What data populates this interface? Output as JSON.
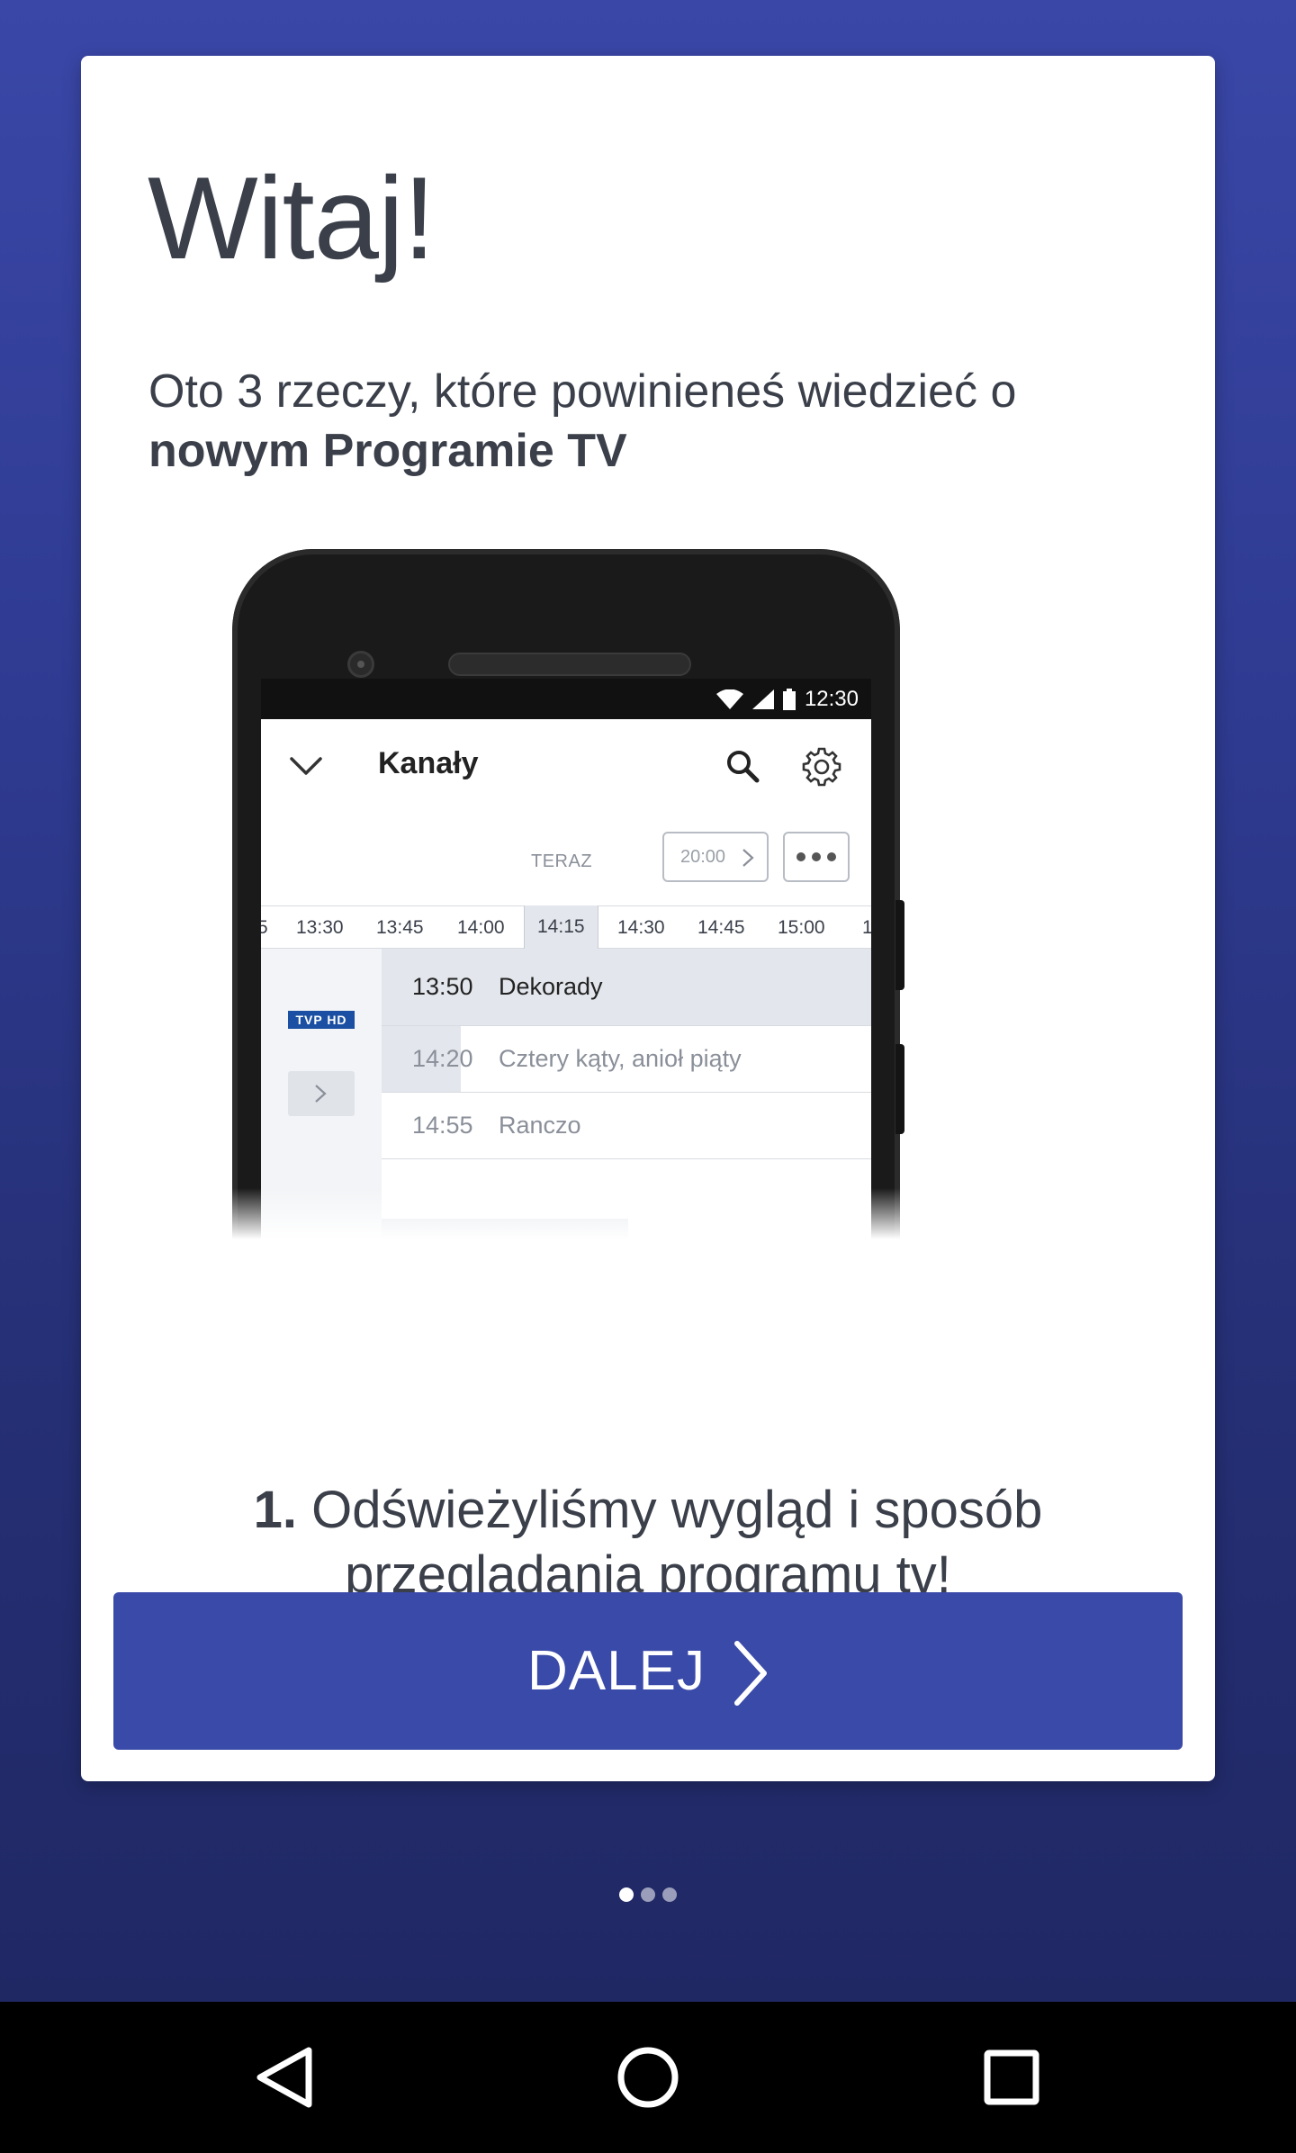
{
  "card": {
    "title": "Witaj!",
    "subtitle_intro": "Oto 3 rzeczy, które powinieneś wiedzieć o",
    "subtitle_bold": "nowym Programie TV"
  },
  "phone_screen": {
    "status_time": "12:30",
    "appbar_title": "Kanały",
    "teraz_label": "TERAZ",
    "time_button": "20:00",
    "timeline_ticks": [
      "5",
      "13:30",
      "13:45",
      "14:00",
      "14:15",
      "14:30",
      "14:45",
      "15:00",
      "1"
    ],
    "timeline_active": "14:15",
    "channel_logo": "TVP HD",
    "programs": [
      {
        "time": "13:50",
        "name": "Dekorady"
      },
      {
        "time": "14:20",
        "name": "Cztery kąty, anioł piąty"
      },
      {
        "time": "14:55",
        "name": "Ranczo"
      }
    ]
  },
  "step": {
    "number": "1.",
    "text_line1": "Odświeżyliśmy wygląd i sposób",
    "text_line2": "przeglądania programu tv!"
  },
  "cta": {
    "label": "DALEJ",
    "icon": "chevron-right-icon"
  },
  "pagination": {
    "total": 3,
    "active": 1
  },
  "navbar": {
    "icons": [
      "back-icon",
      "home-icon",
      "recents-icon"
    ]
  },
  "colors": {
    "background_top": "#3a47a7",
    "background_bottom": "#1f2660",
    "button": "#3a4aa8",
    "text_dark": "#3a3f4a"
  }
}
